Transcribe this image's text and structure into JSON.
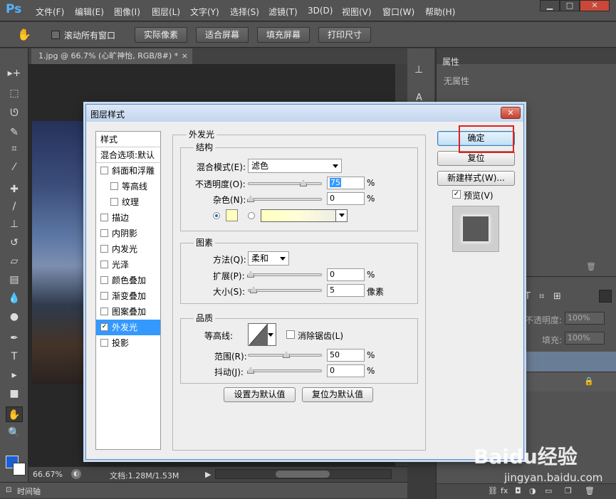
{
  "app": {
    "logo": "Ps"
  },
  "menu": [
    "文件(F)",
    "编辑(E)",
    "图像(I)",
    "图层(L)",
    "文字(Y)",
    "选择(S)",
    "滤镜(T)",
    "3D(D)",
    "视图(V)",
    "窗口(W)",
    "帮助(H)"
  ],
  "options_bar": {
    "scroll_all_label": "滚动所有窗口",
    "buttons": [
      "实际像素",
      "适合屏幕",
      "填充屏幕",
      "打印尺寸"
    ]
  },
  "document": {
    "tab_title": "1.jpg @ 66.7% (心旷神怡, RGB/8#) *",
    "zoom": "66.67%",
    "doc_info": "文档:1.28M/1.53M",
    "timeline_label": "时间轴"
  },
  "properties_panel": {
    "title": "属性",
    "empty_text": "无属性"
  },
  "layers_panel": {
    "opacity_label": "不透明度:",
    "opacity_value": "100%",
    "fill_label": "填充:",
    "fill_value": "100%"
  },
  "dialog": {
    "title": "图层样式",
    "style_list": {
      "header": "样式",
      "blend_default": "混合选项:默认",
      "items": [
        {
          "label": "斜面和浮雕",
          "checked": false,
          "indent": false
        },
        {
          "label": "等高线",
          "checked": false,
          "indent": true
        },
        {
          "label": "纹理",
          "checked": false,
          "indent": true
        },
        {
          "label": "描边",
          "checked": false,
          "indent": false
        },
        {
          "label": "内阴影",
          "checked": false,
          "indent": false
        },
        {
          "label": "内发光",
          "checked": false,
          "indent": false
        },
        {
          "label": "光泽",
          "checked": false,
          "indent": false
        },
        {
          "label": "颜色叠加",
          "checked": false,
          "indent": false
        },
        {
          "label": "渐变叠加",
          "checked": false,
          "indent": false
        },
        {
          "label": "图案叠加",
          "checked": false,
          "indent": false
        },
        {
          "label": "外发光",
          "checked": true,
          "indent": false,
          "selected": true
        },
        {
          "label": "投影",
          "checked": false,
          "indent": false
        }
      ]
    },
    "outer_glow": {
      "title": "外发光",
      "structure": {
        "title": "结构",
        "blend_mode_label": "混合模式(E):",
        "blend_mode_value": "滤色",
        "opacity_label": "不透明度(O):",
        "opacity_value": "75",
        "opacity_unit": "%",
        "noise_label": "杂色(N):",
        "noise_value": "0",
        "noise_unit": "%",
        "glow_color": "#ffffbe"
      },
      "elements": {
        "title": "图素",
        "technique_label": "方法(Q):",
        "technique_value": "柔和",
        "spread_label": "扩展(P):",
        "spread_value": "0",
        "spread_unit": "%",
        "size_label": "大小(S):",
        "size_value": "5",
        "size_unit": "像素"
      },
      "quality": {
        "title": "品质",
        "contour_label": "等高线:",
        "antialias_label": "消除锯齿(L)",
        "range_label": "范围(R):",
        "range_value": "50",
        "range_unit": "%",
        "jitter_label": "抖动(J):",
        "jitter_value": "0",
        "jitter_unit": "%"
      },
      "set_default": "设置为默认值",
      "reset_default": "复位为默认值"
    },
    "buttons": {
      "ok": "确定",
      "reset": "复位",
      "new_style": "新建样式(W)...",
      "preview_label": "预览(V)"
    }
  },
  "watermark": {
    "brand": "Baidu经验",
    "url": "jingyan.baidu.com"
  },
  "colors": {
    "highlight": "#e02020",
    "selection": "#3399ff",
    "foreground": "#1a5fd6",
    "background": "#ffffff"
  }
}
